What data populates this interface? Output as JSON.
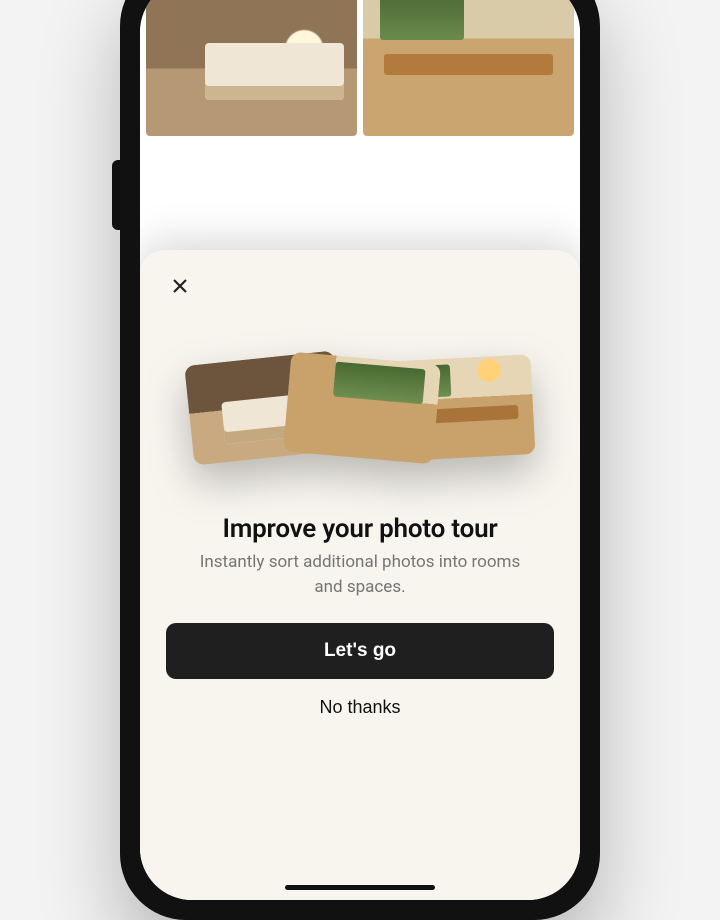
{
  "modal": {
    "title": "Improve your photo tour",
    "subtitle": "Instantly sort additional photos into rooms and spaces.",
    "primary_label": "Let's go",
    "secondary_label": "No thanks"
  },
  "icons": {
    "close": "close-icon"
  },
  "collage": {
    "cards": [
      "bedroom",
      "kitchen",
      "dining"
    ]
  },
  "background_grid": {
    "tiles": [
      "bedroom",
      "dining"
    ]
  }
}
